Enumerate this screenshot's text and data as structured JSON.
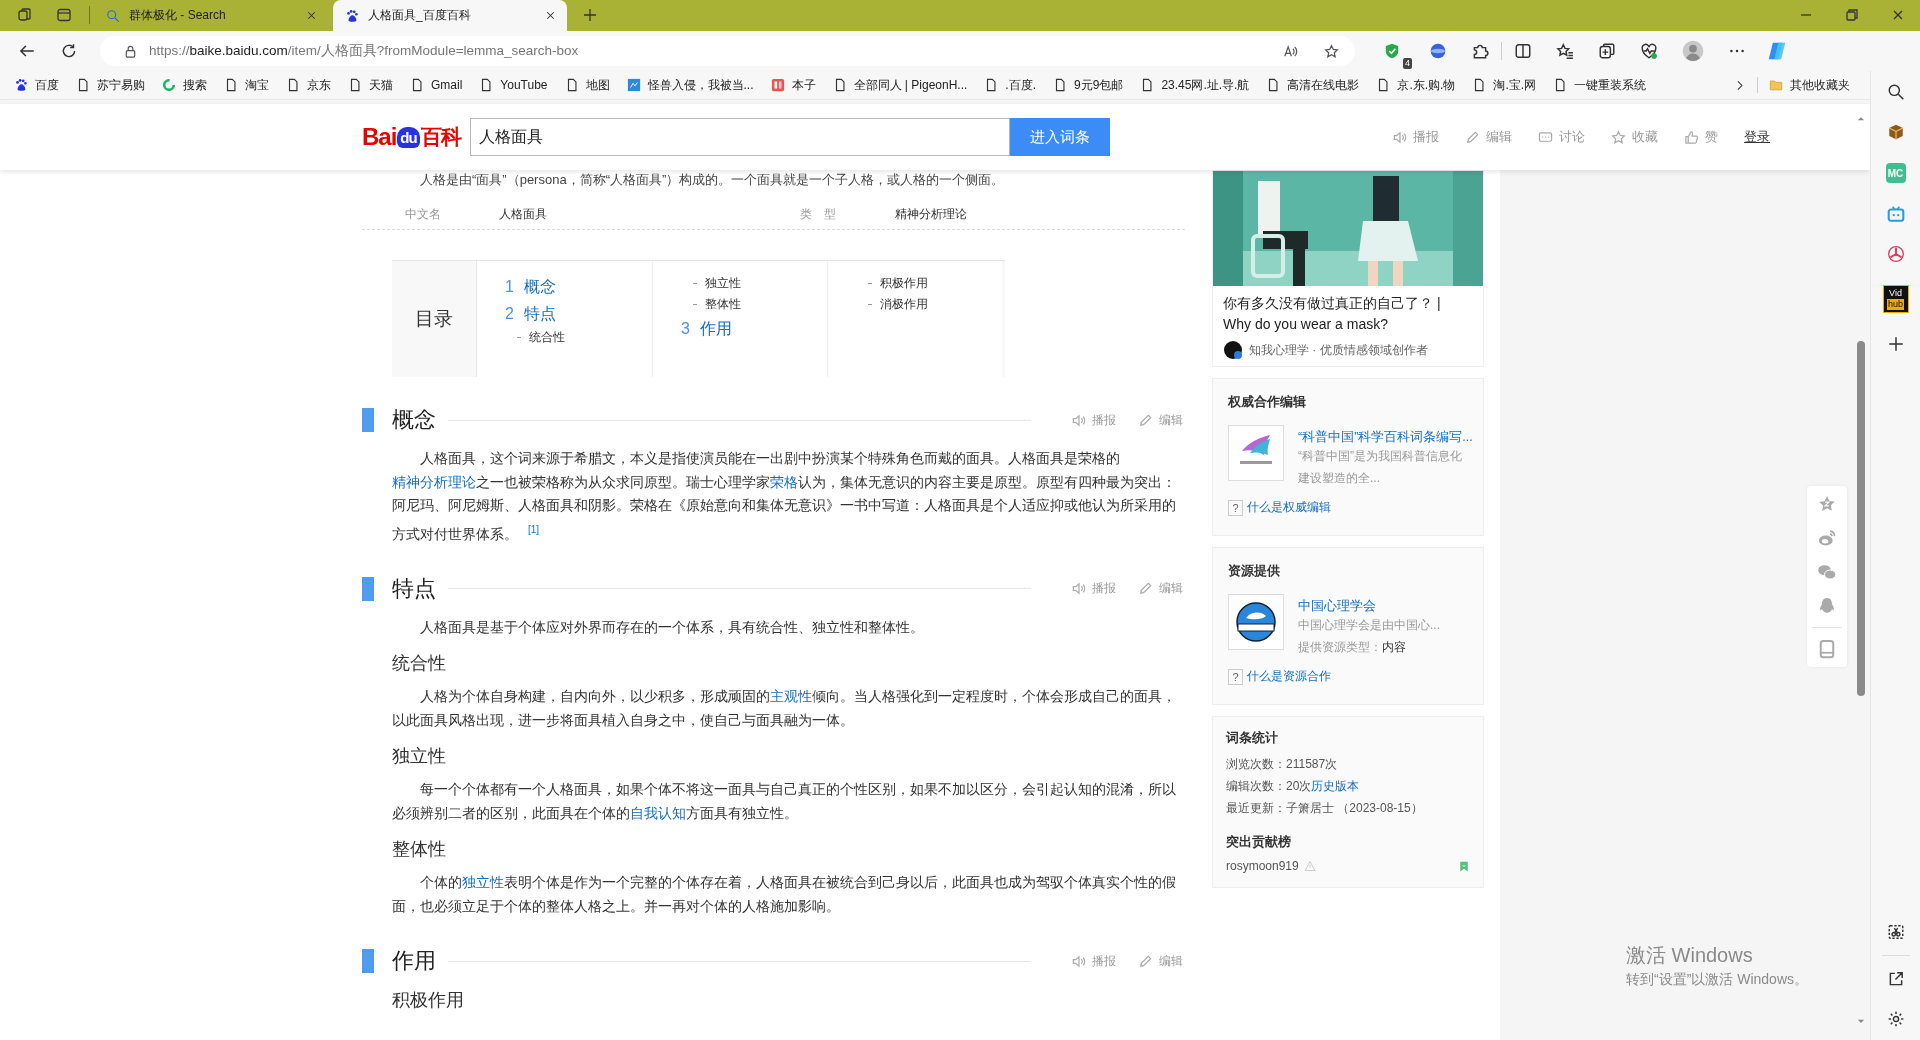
{
  "browser": {
    "tabs": [
      {
        "title": "群体极化 - Search",
        "kind": "search",
        "selected": false
      },
      {
        "title": "人格面具_百度百科",
        "kind": "paw",
        "selected": true
      }
    ],
    "address": {
      "scheme": "https://",
      "host": "baike.baidu.com",
      "path": "/item/人格面具?fromModule=lemma_search-box"
    },
    "extension_badge": "4",
    "bookmarks": [
      {
        "label": "百度",
        "kind": "paw"
      },
      {
        "label": "苏宁易购",
        "kind": "page"
      },
      {
        "label": "搜索",
        "kind": "ring"
      },
      {
        "label": "淘宝",
        "kind": "page"
      },
      {
        "label": "京东",
        "kind": "page"
      },
      {
        "label": "天猫",
        "kind": "page"
      },
      {
        "label": "Gmail",
        "kind": "page"
      },
      {
        "label": "YouTube",
        "kind": "page"
      },
      {
        "label": "地图",
        "kind": "page"
      },
      {
        "label": "怪兽入侵，我被当...",
        "kind": "blue"
      },
      {
        "label": "本子",
        "kind": "red"
      },
      {
        "label": "全部同人 | PigeonH...",
        "kind": "page"
      },
      {
        "label": ".百度.",
        "kind": "page"
      },
      {
        "label": "9元9包邮",
        "kind": "page"
      },
      {
        "label": "23.45网.址.导.航",
        "kind": "page"
      },
      {
        "label": "高清在线电影",
        "kind": "page"
      },
      {
        "label": "京.东.购.物",
        "kind": "page"
      },
      {
        "label": "淘.宝.网",
        "kind": "page"
      },
      {
        "label": "一键重装系统",
        "kind": "page"
      }
    ],
    "other_bookmarks": "其他收藏夹",
    "side_apps": [
      {
        "kind": "cube"
      },
      {
        "kind": "tile",
        "text": "MC"
      },
      {
        "kind": "tv"
      },
      {
        "kind": "tri"
      },
      {
        "kind": "vid",
        "lines": [
          "Vid",
          "hub"
        ]
      }
    ]
  },
  "page": {
    "logo": {
      "left": "Bai",
      "paw": "du",
      "right": "百科"
    },
    "search": {
      "value": "人格面具",
      "button": "进入词条"
    },
    "header_actions": [
      {
        "label": "播报",
        "kind": "speaker"
      },
      {
        "label": "编辑",
        "kind": "pencil"
      },
      {
        "label": "讨论",
        "kind": "chat"
      },
      {
        "label": "收藏",
        "kind": "star"
      },
      {
        "label": "赞",
        "kind": "thumb"
      },
      {
        "label": "登录",
        "kind": "login"
      }
    ],
    "intro": "人格是由“面具”（persona，简称“人格面具”）构成的。一个面具就是一个子人格，或人格的一个侧面。",
    "infobox": [
      {
        "label": "中文名",
        "value": "人格面具"
      },
      {
        "label": "类　型",
        "value": "精神分析理论"
      }
    ],
    "toc": {
      "title": "目录",
      "columns": [
        [
          {
            "kind": "chapter",
            "num": "1",
            "title": "概念"
          },
          {
            "kind": "chapter",
            "num": "2",
            "title": "特点"
          },
          {
            "kind": "sub",
            "title": "统合性"
          }
        ],
        [
          {
            "kind": "sub",
            "title": "独立性"
          },
          {
            "kind": "sub",
            "title": "整体性"
          },
          {
            "kind": "chapter",
            "num": "3",
            "title": "作用"
          }
        ],
        [
          {
            "kind": "sub",
            "title": "积极作用"
          },
          {
            "kind": "sub",
            "title": "消极作用"
          }
        ]
      ]
    },
    "sections": [
      {
        "title": "概念",
        "actions": [
          {
            "label": "播报",
            "kind": "speaker"
          },
          {
            "label": "编辑",
            "kind": "pencil"
          }
        ],
        "blocks": [
          {
            "kind": "paragraph",
            "runs": [
              {
                "text": "人格面具，这个词来源于希腊文，本义是指使演员能在一出剧中扮演某个特殊角色而戴的面具。人格面具是荣格的"
              },
              {
                "kind": "link",
                "text": "精神分析理论"
              },
              {
                "text": "之一也被荣格称为从众求同原型。瑞士心理学家"
              },
              {
                "kind": "link",
                "text": "荣格"
              },
              {
                "text": "认为，集体无意识的内容主要是原型。原型有四种最为突出：阿尼玛、阿尼姆斯、人格面具和阴影。荣格在《原始意向和集体无意识》一书中写道：人格面具是个人适应抑或他认为所采用的方式对付世界体系。"
              },
              {
                "kind": "ref",
                "text": "[1]"
              }
            ]
          }
        ]
      },
      {
        "title": "特点",
        "actions": [
          {
            "label": "播报",
            "kind": "speaker"
          },
          {
            "label": "编辑",
            "kind": "pencil"
          }
        ],
        "blocks": [
          {
            "kind": "paragraph",
            "runs": [
              {
                "text": "人格面具是基于个体应对外界而存在的一个体系，具有统合性、独立性和整体性。"
              }
            ]
          },
          {
            "kind": "subheading",
            "text": "统合性"
          },
          {
            "kind": "paragraph",
            "runs": [
              {
                "text": "人格为个体自身构建，自内向外，以少积多，形成顽固的"
              },
              {
                "kind": "link",
                "text": "主观性"
              },
              {
                "text": "倾向。当人格强化到一定程度时，个体会形成自己的面具，以此面具风格出现，进一步将面具植入自身之中，使自己与面具融为一体。"
              }
            ]
          },
          {
            "kind": "subheading",
            "text": "独立性"
          },
          {
            "kind": "paragraph",
            "runs": [
              {
                "text": "每一个个体都有一个人格面具，如果个体不将这一面具与自己真正的个性区别，如果不加以区分，会引起认知的混淆，所以必须辨别二者的区别，此面具在个体的"
              },
              {
                "kind": "link",
                "text": "自我认知"
              },
              {
                "text": "方面具有独立性。"
              }
            ]
          },
          {
            "kind": "subheading",
            "text": "整体性"
          },
          {
            "kind": "paragraph",
            "runs": [
              {
                "text": "个体的"
              },
              {
                "kind": "link",
                "text": "独立性"
              },
              {
                "text": "表明个体是作为一个完整的个体存在着，人格面具在被统合到己身以后，此面具也成为驾驭个体真实个性的假面，也必须立足于个体的整体人格之上。并一再对个体的人格施加影响。"
              }
            ]
          }
        ]
      },
      {
        "title": "作用",
        "actions": [
          {
            "label": "播报",
            "kind": "speaker"
          },
          {
            "label": "编辑",
            "kind": "pencil"
          }
        ],
        "blocks": [
          {
            "kind": "subheading",
            "text": "积极作用"
          }
        ]
      }
    ],
    "sidebar": {
      "feature": {
        "title": "你有多久没有做过真正的自己了？ | Why do you wear a mask?",
        "author": "知我心理学 · 优质情感领域创作者"
      },
      "authority": {
        "title": "权威合作编辑",
        "name": "“科普中国”科学百科词条编写...",
        "lines": [
          "“科普中国”是为我国科普信息化",
          "建设塑造的全..."
        ],
        "help_mark": "?",
        "help": "什么是权威编辑"
      },
      "resource": {
        "title": "资源提供",
        "name": "中国心理学会",
        "lines": [
          "中国心理学会是由中国心..."
        ],
        "meta_label": "提供资源类型：",
        "meta_value": "内容",
        "help_mark": "?",
        "help": "什么是资源合作"
      },
      "stats": {
        "title": "词条统计",
        "rows": [
          [
            {
              "text": "浏览次数：211587次"
            }
          ],
          [
            {
              "text": "编辑次数：20次"
            },
            {
              "kind": "link",
              "text": "历史版本"
            }
          ],
          [
            {
              "text": "最近更新：子箫居士 （2023-08-15）"
            }
          ]
        ],
        "contributors_title": "突出贡献榜",
        "contributors": [
          {
            "name": "rosymoon919"
          }
        ]
      }
    },
    "os_notice": {
      "title": "激活 Windows",
      "subtitle": "转到“设置”以激活 Windows。"
    }
  }
}
